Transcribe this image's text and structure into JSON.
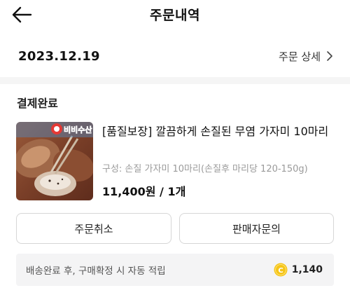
{
  "header": {
    "title": "주문내역"
  },
  "order": {
    "date": "2023.12.19",
    "detail_label": "주문 상세",
    "status": "결제완료"
  },
  "product": {
    "brand_text": "비비수산",
    "name": "[품질보장] 깔끔하게 손질된 무염 가자미 10마리",
    "option": "구성: 손질 가자미 10마리(손질후 마리당 120-150g)",
    "price": "11,400원 / 1개"
  },
  "actions": {
    "cancel_label": "주문취소",
    "inquiry_label": "판매자문의"
  },
  "points": {
    "message": "배송완료 후, 구매확정 시 자동 적립",
    "value": "1,140",
    "coin_symbol": "C"
  },
  "colors": {
    "coin": "#f5c518",
    "divider": "#f5f5f5",
    "points_bg": "#f4f4f5"
  }
}
